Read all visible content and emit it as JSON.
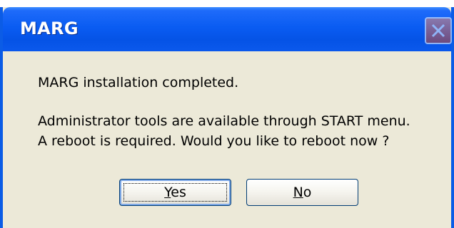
{
  "dialog": {
    "title": "MARG",
    "message_line1": "MARG installation completed.",
    "message_line2": "Administrator tools are available through START menu.",
    "message_line3": "A reboot is required. Would you like to reboot now ?",
    "buttons": {
      "yes_mnemonic": "Y",
      "yes_rest": "es",
      "no_mnemonic": "N",
      "no_rest": "o"
    }
  },
  "colors": {
    "titlebar": "#0553E6",
    "body": "#ECE9D8",
    "button_border": "#003C74"
  },
  "icons": {
    "close": "close-icon"
  }
}
